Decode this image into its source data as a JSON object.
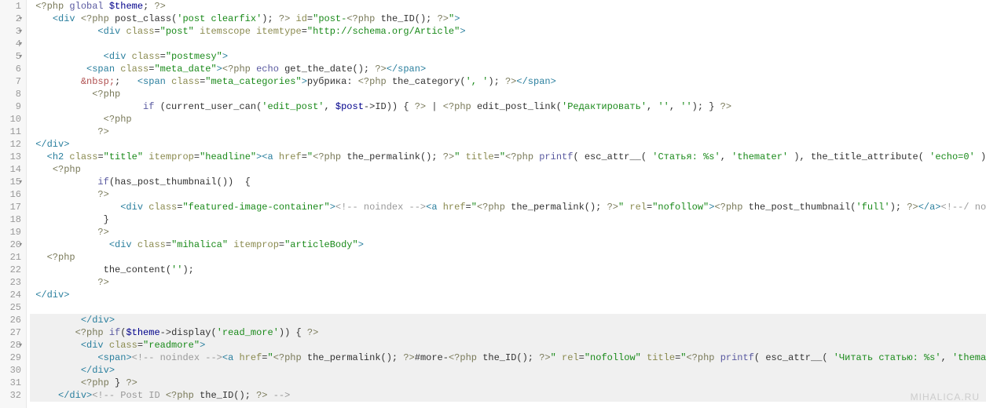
{
  "editor": {
    "gutter": {
      "lines": [
        {
          "n": "1",
          "fold": false
        },
        {
          "n": "2",
          "fold": true
        },
        {
          "n": "3",
          "fold": true
        },
        {
          "n": "4",
          "fold": true
        },
        {
          "n": "5",
          "fold": true
        },
        {
          "n": "6",
          "fold": false
        },
        {
          "n": "7",
          "fold": false
        },
        {
          "n": "8",
          "fold": false
        },
        {
          "n": "9",
          "fold": false
        },
        {
          "n": "10",
          "fold": false
        },
        {
          "n": "11",
          "fold": false
        },
        {
          "n": "12",
          "fold": false
        },
        {
          "n": "13",
          "fold": false
        },
        {
          "n": "14",
          "fold": false
        },
        {
          "n": "15",
          "fold": true
        },
        {
          "n": "16",
          "fold": false
        },
        {
          "n": "17",
          "fold": false
        },
        {
          "n": "18",
          "fold": false
        },
        {
          "n": "19",
          "fold": false
        },
        {
          "n": "20",
          "fold": true
        },
        {
          "n": "21",
          "fold": false
        },
        {
          "n": "22",
          "fold": false
        },
        {
          "n": "23",
          "fold": false
        },
        {
          "n": "24",
          "fold": false
        },
        {
          "n": "25",
          "fold": false
        },
        {
          "n": "26",
          "fold": false
        },
        {
          "n": "27",
          "fold": false
        },
        {
          "n": "28",
          "fold": true
        },
        {
          "n": "29",
          "fold": false
        },
        {
          "n": "30",
          "fold": false
        },
        {
          "n": "31",
          "fold": false
        },
        {
          "n": "32",
          "fold": false
        }
      ]
    },
    "lines": {
      "l1": {
        "php_open": "<?php",
        "kw": "global",
        "var": "$theme",
        "semi": ";",
        "php_close": "?>"
      },
      "l2": {
        "open": "<",
        "tag": "div",
        "php_open": "<?php",
        "fn": "post_class",
        "arg": "'post clearfix'",
        "close_call": ");",
        "php_close": "?>",
        "attr1": "id",
        "eq": "=",
        "q": "\"",
        "val1a": "post-",
        "php_open2": "<?php",
        "fn2": "the_ID",
        "call2": "();",
        "php_close2": "?>",
        "q2": "\"",
        "gt": ">"
      },
      "l3": {
        "open": "<",
        "tag": "div",
        "attr1": "class",
        "val1": "\"post\"",
        "attr2": "itemscope",
        "attr3": "itemtype",
        "val3": "\"http://schema.org/Article\"",
        "gt": ">"
      },
      "l4": "",
      "l5": {
        "open": "<",
        "tag": "div",
        "attr": "class",
        "val": "\"postmesy\"",
        "gt": ">"
      },
      "l6": {
        "open": "<",
        "tag": "span",
        "attr": "class",
        "val": "\"meta_date\"",
        "gt": ">",
        "php_open": "<?php",
        "kw": "echo",
        "fn": "get_the_date",
        "call": "();",
        "php_close": "?>",
        "close_open": "</",
        "close_tag": "span",
        "close_gt": ">"
      },
      "l7": {
        "ent": "&nbsp;",
        "semi": ";",
        "open": "<",
        "tag": "span",
        "attr": "class",
        "val": "\"meta_categories\"",
        "gt": ">",
        "txt": "рубрика: ",
        "php_open": "<?php",
        "fn": "the_category",
        "arg": "', '",
        "close_call": ");",
        "php_close": "?>",
        "close_open": "</",
        "close_tag": "span",
        "close_gt": ">"
      },
      "l8": {
        "php_open": "<?php"
      },
      "l9": {
        "kw": "if",
        "open": "(",
        "fn": "current_user_can",
        "arg1": "'edit_post'",
        "comma": ", ",
        "var": "$post",
        "arrow": "->",
        "prop": "ID",
        "close": ")) { ",
        "php_close": "?>",
        "pipe": " | ",
        "php_open2": "<?php",
        "fn2": "edit_post_link",
        "arg2a": "'Редактировать'",
        "c2": ", ",
        "arg2b": "''",
        "c3": ", ",
        "arg2c": "''",
        "close2": "); } ",
        "php_close2": "?>"
      },
      "l10": {
        "php_open": "<?php"
      },
      "l11": {
        "php_close": "?>"
      },
      "l12": {
        "close_open": "</",
        "tag": "div",
        "gt": ">"
      },
      "l13": {
        "open": "<",
        "tag": "h2",
        "attr1": "class",
        "val1": "\"title\"",
        "attr2": "itemprop",
        "val2": "\"headline\"",
        "gt": ">",
        "open2": "<",
        "tag2": "a",
        "attr3": "href",
        "q": "\"",
        "php_open": "<?php",
        "fn": "the_permalink",
        "call": "();",
        "php_close": "?>",
        "q2": "\"",
        "attr4": "title",
        "q3": "\"",
        "php_open2": "<?php",
        "fn2": "printf",
        "p": "( ",
        "fn3": "esc_attr__",
        "p2": "( ",
        "arg1": "'Статья: %s'",
        "c": ", ",
        "arg2": "'themater'",
        "p3": " )",
        "c2": ", ",
        "fn4": "the_title_attribute",
        "p4": "( ",
        "arg3": "'echo=0'",
        "p5": " ) );",
        "php_close2": "?>"
      },
      "l14": {
        "php_open": "<?php"
      },
      "l15": {
        "kw": "if",
        "open": "(",
        "fn": "has_post_thumbnail",
        "call": "())",
        "brace": "  {"
      },
      "l16": {
        "php_close": "?>"
      },
      "l17": {
        "open": "<",
        "tag": "div",
        "attr": "class",
        "val": "\"featured-image-container\"",
        "gt": ">",
        "cmt": "<!-- noindex -->",
        "open2": "<",
        "tag2": "a",
        "attr2": "href",
        "q": "\"",
        "php_open": "<?php",
        "fn": "the_permalink",
        "call": "();",
        "php_close": "?>",
        "q2": "\"",
        "attr3": "rel",
        "val3": "\"nofollow\"",
        "gt2": ">",
        "php_open2": "<?php",
        "fn2": "the_post_thumbnail",
        "arg": "'full'",
        "close2": ");",
        "php_close2": "?>",
        "close_a": "</",
        "tag_a": "a",
        "gt_a": ">",
        "cmt2": "<!--/ noindex"
      },
      "l18": {
        "brace": "}"
      },
      "l19": {
        "php_close": "?>"
      },
      "l20": {
        "open": "<",
        "tag": "div",
        "attr1": "class",
        "val1": "\"mihalica\"",
        "attr2": "itemprop",
        "val2": "\"articleBody\"",
        "gt": ">"
      },
      "l21": {
        "php_open": "<?php"
      },
      "l22": {
        "fn": "the_content",
        "arg": "''",
        "close": ");"
      },
      "l23": {
        "php_close": "?>"
      },
      "l24": {
        "close_open": "</",
        "tag": "div",
        "gt": ">"
      },
      "l25": "",
      "l26": {
        "close_open": "</",
        "tag": "div",
        "gt": ">"
      },
      "l27": {
        "php_open": "<?php",
        "kw": "if",
        "open": "(",
        "var": "$theme",
        "arrow": "->",
        "fn": "display",
        "arg": "'read_more'",
        "close": ")) { ",
        "php_close": "?>"
      },
      "l28": {
        "open": "<",
        "tag": "div",
        "attr": "class",
        "val": "\"readmore\"",
        "gt": ">"
      },
      "l29": {
        "open": "<",
        "tag": "span",
        "gt": ">",
        "cmt": "<!-- noindex -->",
        "open2": "<",
        "tag2": "a",
        "attr": "href",
        "q": "\"",
        "php_open": "<?php",
        "fn": "the_permalink",
        "call": "();",
        "php_close": "?>",
        "txt": "#more-",
        "php_open2": "<?php",
        "fn2": "the_ID",
        "call2": "();",
        "php_close2": "?>",
        "q2": "\"",
        "attr2": "rel",
        "val2": "\"nofollow\"",
        "attr3": "title",
        "q3": "\"",
        "php_open3": "<?php",
        "fn3": "printf",
        "p": "( ",
        "fn4": "esc_attr__",
        "p2": "( ",
        "arg1": "'Читать статью: %s'",
        "c": ", ",
        "arg2": "'themater'"
      },
      "l30": {
        "close_open": "</",
        "tag": "div",
        "gt": ">"
      },
      "l31": {
        "php_open": "<?php",
        "brace": " } ",
        "php_close": "?>"
      },
      "l32": {
        "close_open": "</",
        "tag": "div",
        "gt": ">",
        "cmt_open": "<!-- ",
        "cmt_txt": "Post ID ",
        "php_open": "<?php",
        "fn": "the_ID",
        "call": "();",
        "php_close": "?>",
        "cmt_close": " -->"
      }
    }
  },
  "watermark": "MIHALICA.RU"
}
